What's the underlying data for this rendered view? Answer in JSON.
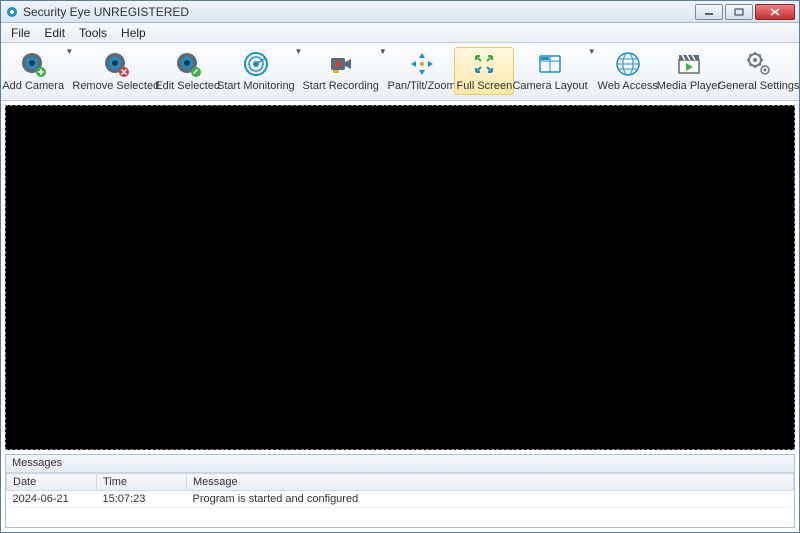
{
  "window": {
    "title": "Security Eye UNREGISTERED"
  },
  "menubar": {
    "items": [
      "File",
      "Edit",
      "Tools",
      "Help"
    ]
  },
  "toolbar": {
    "add_camera": "Add Camera",
    "remove_selected": "Remove Selected",
    "edit_selected": "Edit Selected",
    "start_monitoring": "Start Monitoring",
    "start_recording": "Start Recording",
    "pan_tilt_zoom": "Pan/Tilt/Zoom",
    "full_screen": "Full Screen",
    "camera_layout": "Camera Layout",
    "web_access": "Web Access",
    "media_player": "Media Player",
    "general_settings": "General Settings"
  },
  "messages": {
    "title": "Messages",
    "columns": {
      "date": "Date",
      "time": "Time",
      "message": "Message"
    },
    "rows": [
      {
        "date": "2024-06-21",
        "time": "15:07:23",
        "message": "Program is started and configured"
      }
    ]
  },
  "colors": {
    "accent": "#1e90c8",
    "green": "#3cb043",
    "red": "#d04040"
  }
}
